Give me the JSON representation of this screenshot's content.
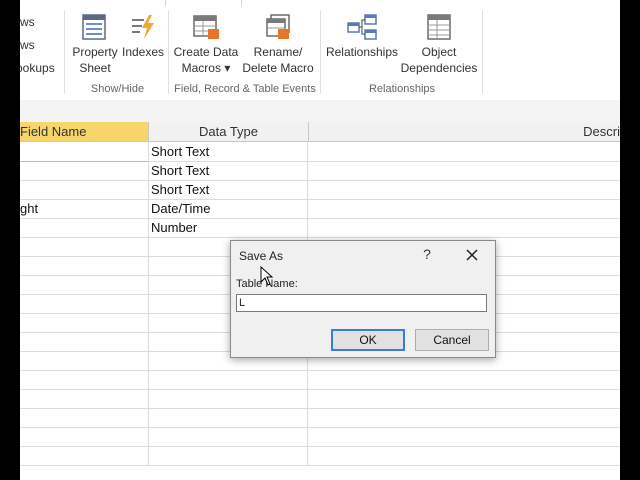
{
  "ribbon": {
    "left_items": [
      "ws",
      "ws",
      "ookups"
    ],
    "buttons": {
      "property_sheet": [
        "Property",
        "Sheet"
      ],
      "indexes": [
        "Indexes"
      ],
      "create_data_macros": [
        "Create Data",
        "Macros ▾"
      ],
      "rename_delete_macro": [
        "Rename/",
        "Delete Macro"
      ],
      "relationships": [
        "Relationships"
      ],
      "object_dependencies": [
        "Object",
        "Dependencies"
      ]
    },
    "groups": {
      "show_hide": "Show/Hide",
      "events": "Field, Record & Table Events",
      "relationships": "Relationships"
    }
  },
  "table": {
    "headers": {
      "field_name": "Field Name",
      "data_type": "Data Type",
      "description": "Descri"
    },
    "rows": [
      {
        "field": "",
        "type": "Short Text"
      },
      {
        "field": "",
        "type": "Short Text"
      },
      {
        "field": "",
        "type": "Short Text"
      },
      {
        "field": "ght",
        "type": "Date/Time"
      },
      {
        "field": "",
        "type": "Number"
      },
      {
        "field": "",
        "type": ""
      },
      {
        "field": "",
        "type": ""
      },
      {
        "field": "",
        "type": ""
      },
      {
        "field": "",
        "type": ""
      },
      {
        "field": "",
        "type": ""
      },
      {
        "field": "",
        "type": ""
      },
      {
        "field": "",
        "type": ""
      },
      {
        "field": "",
        "type": ""
      },
      {
        "field": "",
        "type": ""
      },
      {
        "field": "",
        "type": ""
      },
      {
        "field": "",
        "type": ""
      },
      {
        "field": "",
        "type": ""
      }
    ]
  },
  "dialog": {
    "title": "Save As",
    "help": "?",
    "label": "Table Name:",
    "input_value": "L",
    "ok": "OK",
    "cancel": "Cancel"
  },
  "colors": {
    "header_highlight": "#f6d66a",
    "ok_border": "#3d7bd8"
  }
}
